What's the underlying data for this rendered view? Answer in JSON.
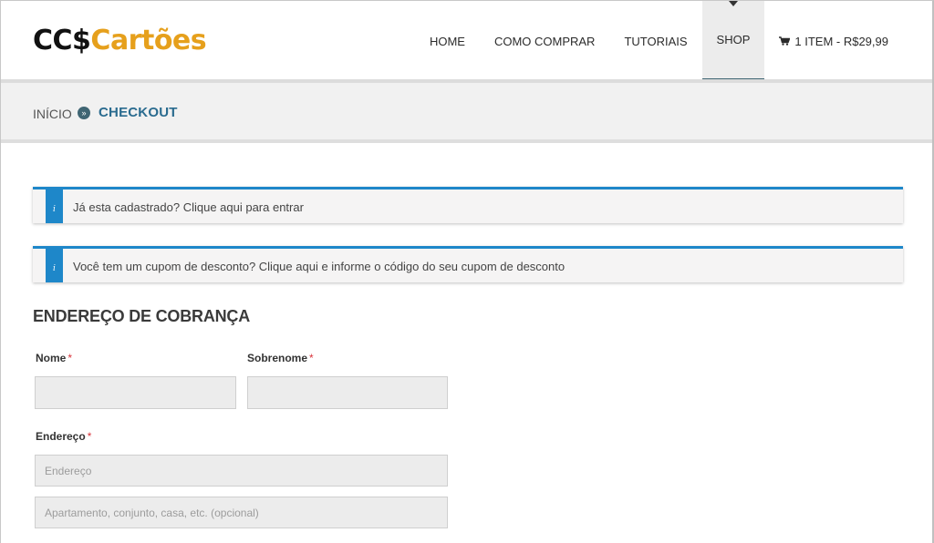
{
  "logo": {
    "part1": "CC$",
    "part2": "Cartões"
  },
  "nav": {
    "items": [
      {
        "label": "HOME"
      },
      {
        "label": "COMO COMPRAR"
      },
      {
        "label": "TUTORIAIS"
      },
      {
        "label": "SHOP"
      }
    ],
    "cart_label": "1 ITEM - R$29,99"
  },
  "breadcrumb": {
    "home": "INÍCIO",
    "current": "CHECKOUT"
  },
  "notices": {
    "login": "Já esta cadastrado? Clique aqui para entrar",
    "coupon": "Você tem um cupom de desconto? Clique aqui e informe o código do seu cupom de desconto",
    "icon_glyph": "i"
  },
  "billing": {
    "title": "ENDEREÇO DE COBRANÇA",
    "required_mark": "*",
    "first_name_label": "Nome",
    "last_name_label": "Sobrenome",
    "address_label": "Endereço",
    "address_placeholder": "Endereço",
    "address2_placeholder": "Apartamento, conjunto, casa, etc. (opcional)"
  },
  "colors": {
    "accent": "#1e87c9",
    "brand_orange": "#e6a01c",
    "nav_active_bar": "#3f6573",
    "required": "#d9333a"
  }
}
